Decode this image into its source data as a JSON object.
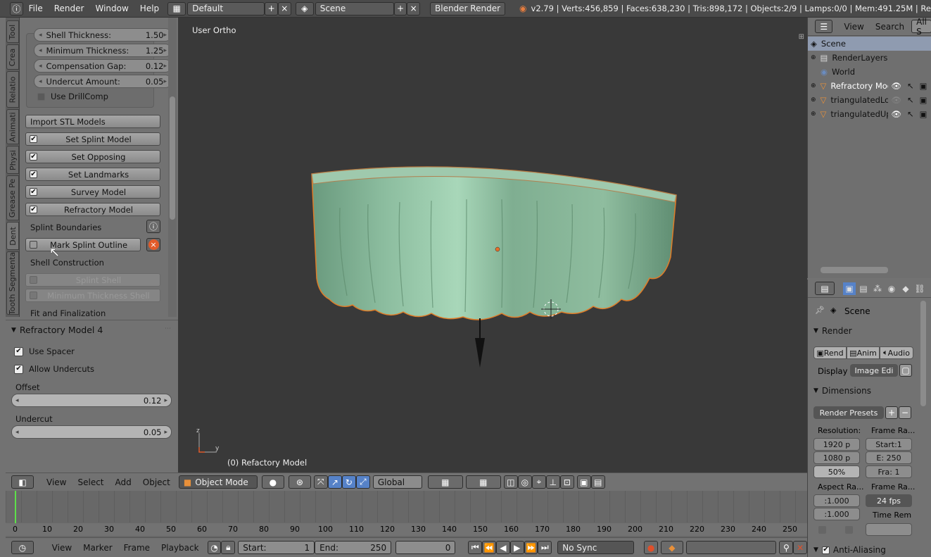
{
  "topbar": {
    "menus": [
      "File",
      "Render",
      "Window",
      "Help"
    ],
    "layout": "Default",
    "scene": "Scene",
    "engine": "Blender Render",
    "stats": "v2.79 | Verts:456,859 | Faces:638,230 | Tris:898,172 | Objects:2/9 | Lamps:0/0 | Mem:491.25M | Re"
  },
  "tabs": [
    "Tool",
    "Crea",
    "Relatio",
    "Animati",
    "Physi",
    "Grease Pe",
    "Dent",
    "Tooth Segmenta"
  ],
  "tool": {
    "fields": [
      {
        "label": "Shell Thickness:",
        "value": "1.50"
      },
      {
        "label": "Minimum Thickness:",
        "value": "1.25"
      },
      {
        "label": "Compensation Gap:",
        "value": "0.12"
      },
      {
        "label": "Undercut Amount:",
        "value": "0.05"
      }
    ],
    "drill": "Use DrillComp",
    "import": "Import STL Models",
    "checks": [
      "Set Splint Model",
      "Set Opposing",
      "Set Landmarks",
      "Survey Model",
      "Refractory Model"
    ],
    "boundaries": "Splint Boundaries",
    "mark": "Mark Splint Outline",
    "shell": "Shell Construction",
    "splint_shell": "Splint Shell",
    "min_shell": "Minimum Thickness Shell",
    "fit": "Fit and Finalization"
  },
  "refractory": {
    "title": "Refractory Model 4",
    "use_spacer": "Use Spacer",
    "allow": "Allow Undercuts",
    "offset_label": "Offset",
    "offset": "0.12",
    "undercut_label": "Undercut",
    "undercut": "0.05"
  },
  "viewport": {
    "view_name": "User Ortho",
    "object": "(0) Refactory Model",
    "axis_z": "z",
    "axis_y": "y"
  },
  "v3d": {
    "menus": [
      "View",
      "Select",
      "Add",
      "Object"
    ],
    "mode": "Object Mode",
    "orient": "Global"
  },
  "timeline": {
    "ticks": [
      "0",
      "10",
      "20",
      "30",
      "40",
      "50",
      "60",
      "70",
      "80",
      "90",
      "100",
      "110",
      "120",
      "130",
      "140",
      "150",
      "160",
      "170",
      "180",
      "190",
      "200",
      "210",
      "220",
      "230",
      "240",
      "250"
    ],
    "menus": [
      "View",
      "Marker",
      "Frame",
      "Playback"
    ],
    "start_label": "Start:",
    "start": "1",
    "end_label": "End:",
    "end": "250",
    "current": "0",
    "sync": "No Sync"
  },
  "outliner": {
    "menus": [
      "View",
      "Search"
    ],
    "filter": "All S",
    "rows": [
      "Scene",
      "RenderLayers",
      "World",
      "Refractory Mod",
      "triangulatedLov",
      "triangulatedUpp"
    ]
  },
  "props": {
    "scene": "Scene",
    "render": "Render",
    "rend": "Rend",
    "anim": "Anim",
    "audio": "Audio",
    "display": "Display",
    "display_val": "Image Edi",
    "dimensions": "Dimensions",
    "presets": "Render Presets",
    "resolution": "Resolution:",
    "res_x": "1920 p",
    "res_y": "1080 p",
    "res_pct": "50%",
    "frame_range": "Frame Ra...",
    "f_start": "Start:1",
    "f_end": "E: 250",
    "f_cur": "Fra:  1",
    "aspect": "Aspect Ra...",
    "asp_x": ":1.000",
    "asp_y": ":1.000",
    "frame_rate": "Frame Ra...",
    "fps": "24 fps",
    "time_rem": "Time Rem",
    "anti_alias": "Anti-Aliasing"
  }
}
